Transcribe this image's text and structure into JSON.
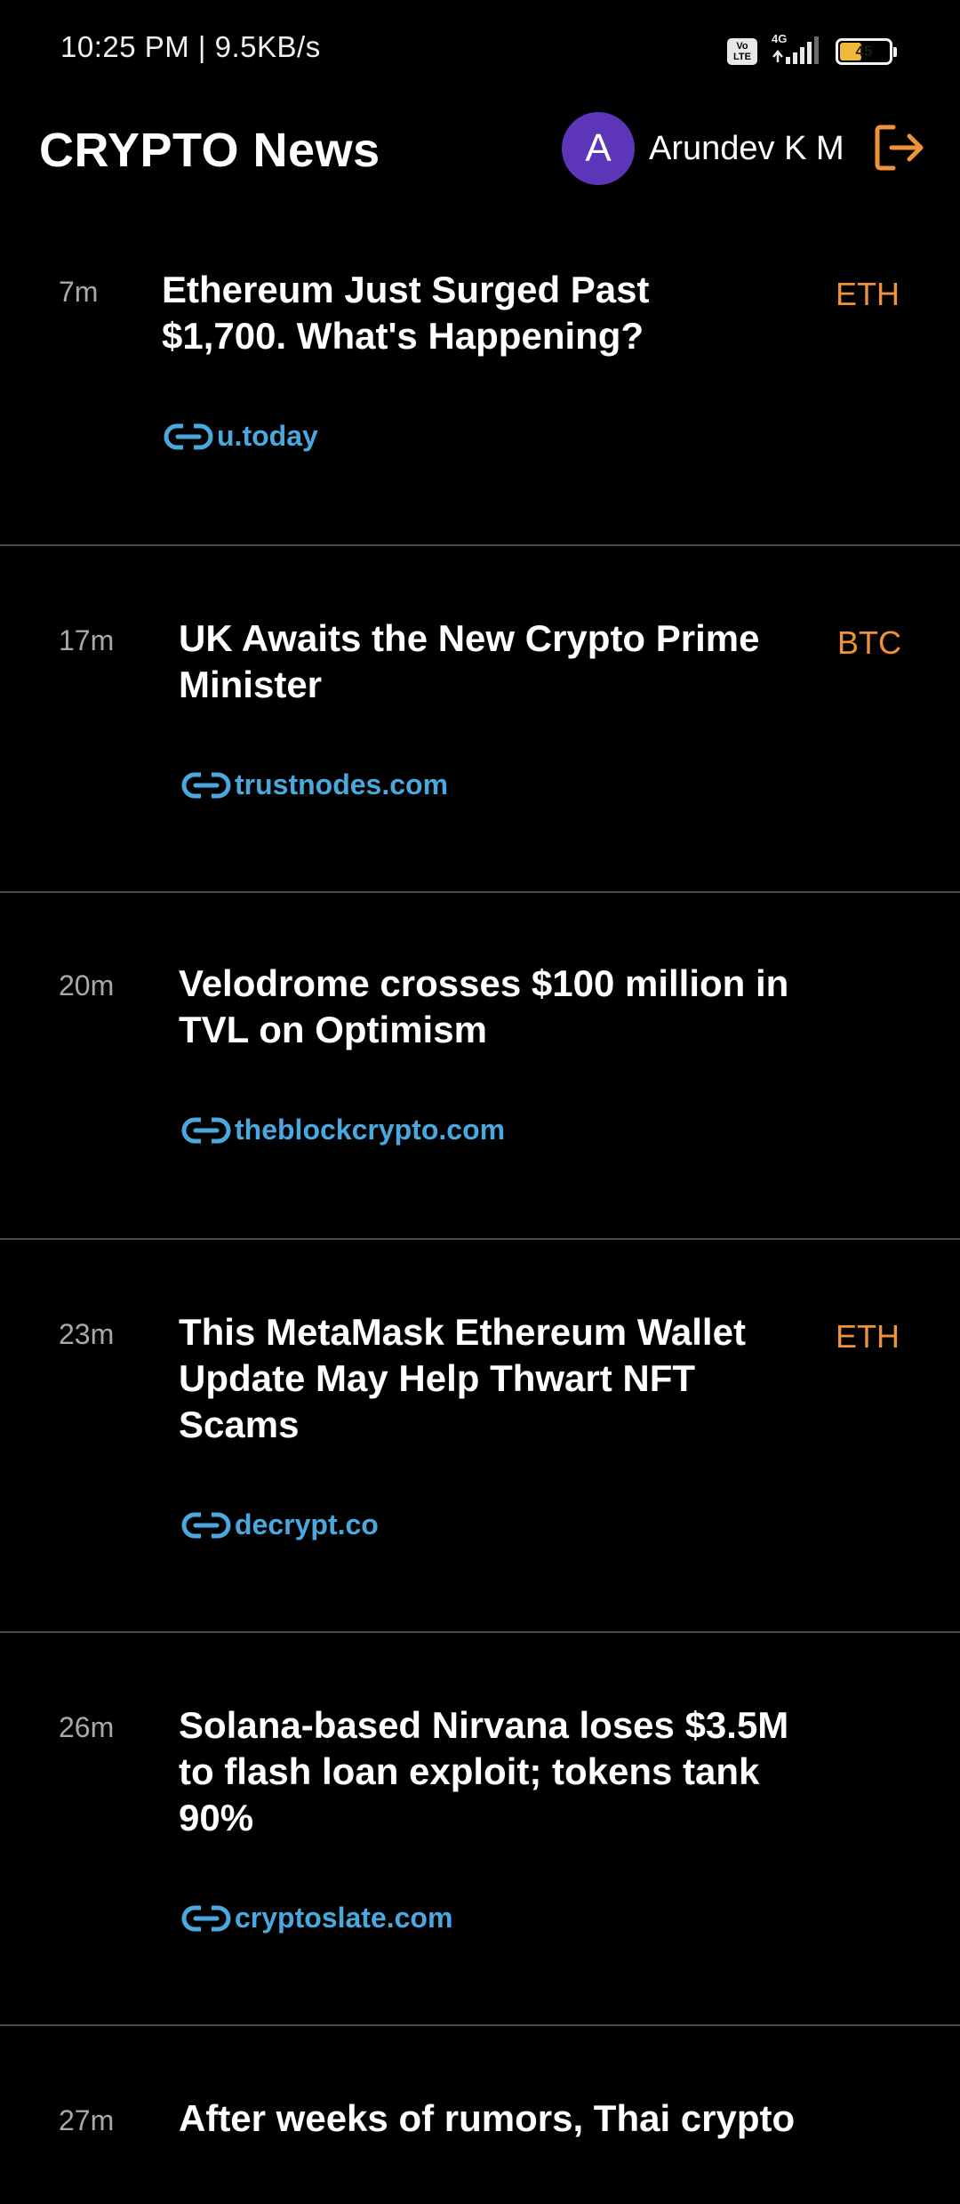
{
  "status_bar": {
    "time_speed": "10:25 PM | 9.5KB/s",
    "volte": "Vo LTE",
    "network_type": "4G",
    "battery_level": "45",
    "battery_fraction": 0.45
  },
  "header": {
    "title": "CRYPTO News",
    "user": {
      "avatar_letter": "A",
      "name": "Arundev K M"
    },
    "logout_icon": "logout-icon"
  },
  "colors": {
    "background": "#000000",
    "title_text": "#ffffff",
    "age_text": "#a8a8a8",
    "tag": "#f0923a",
    "source_link": "#4aa8de",
    "avatar": "#5c35b8",
    "divider": "#4a4a4a",
    "logout": "#f0923a"
  },
  "news": [
    {
      "age": "7m",
      "title": "Ethereum Just Surged Past $1,700. What's Happening?",
      "tag": "ETH",
      "source": "u.today"
    },
    {
      "age": "17m",
      "title": "UK Awaits the New Crypto Prime Minister",
      "tag": "BTC",
      "source": "trustnodes.com"
    },
    {
      "age": "20m",
      "title": "Velodrome crosses $100 million in TVL on Optimism",
      "tag": "",
      "source": "theblockcrypto.com"
    },
    {
      "age": "23m",
      "title": "This MetaMask Ethereum Wallet Update May Help Thwart NFT Scams",
      "tag": "ETH",
      "source": "decrypt.co"
    },
    {
      "age": "26m",
      "title": "Solana-based Nirvana loses $3.5M to flash loan exploit; tokens tank 90%",
      "tag": "",
      "source": "cryptoslate.com"
    },
    {
      "age": "27m",
      "title": "After weeks of rumors, Thai crypto",
      "tag": "",
      "source": ""
    }
  ]
}
